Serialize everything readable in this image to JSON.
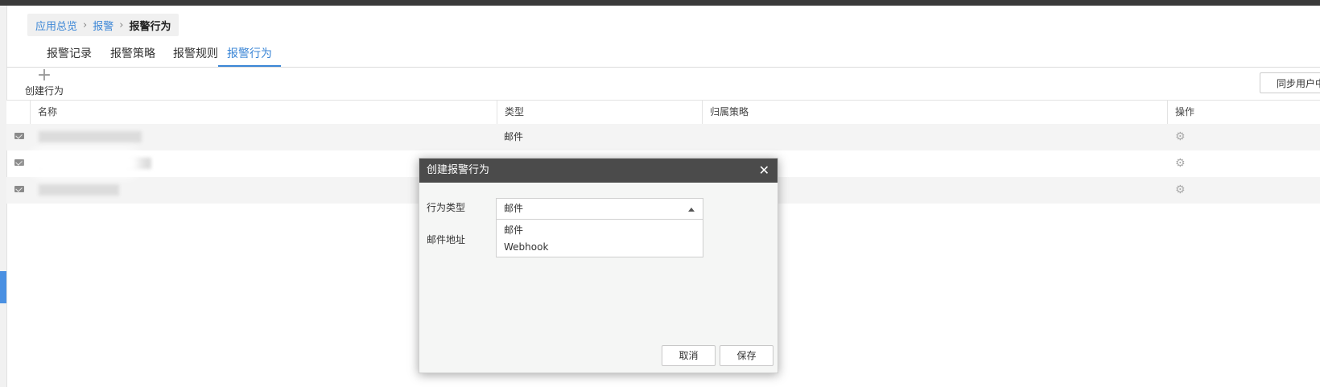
{
  "breadcrumb": {
    "items": [
      "应用总览",
      "报警"
    ],
    "current": "报警行为"
  },
  "tabs": [
    "报警记录",
    "报警策略",
    "报警规则",
    "报警行为"
  ],
  "active_tab": "报警行为",
  "toolbar": {
    "create_label": "创建行为",
    "sync_label": "同步用户中"
  },
  "table": {
    "columns": [
      "名称",
      "类型",
      "归属策略",
      "操作"
    ],
    "rows": [
      {
        "type": "邮件"
      },
      {
        "type": ""
      },
      {
        "type": ""
      }
    ]
  },
  "dialog": {
    "title": "创建报警行为",
    "fields": {
      "action_type_label": "行为类型",
      "email_label": "邮件地址"
    },
    "select": {
      "value": "邮件",
      "options": [
        "邮件",
        "Webhook"
      ]
    },
    "cancel_label": "取消",
    "save_label": "保存"
  },
  "colors": {
    "accent": "#3b86d6",
    "dialog_header": "#4b4b4b"
  }
}
